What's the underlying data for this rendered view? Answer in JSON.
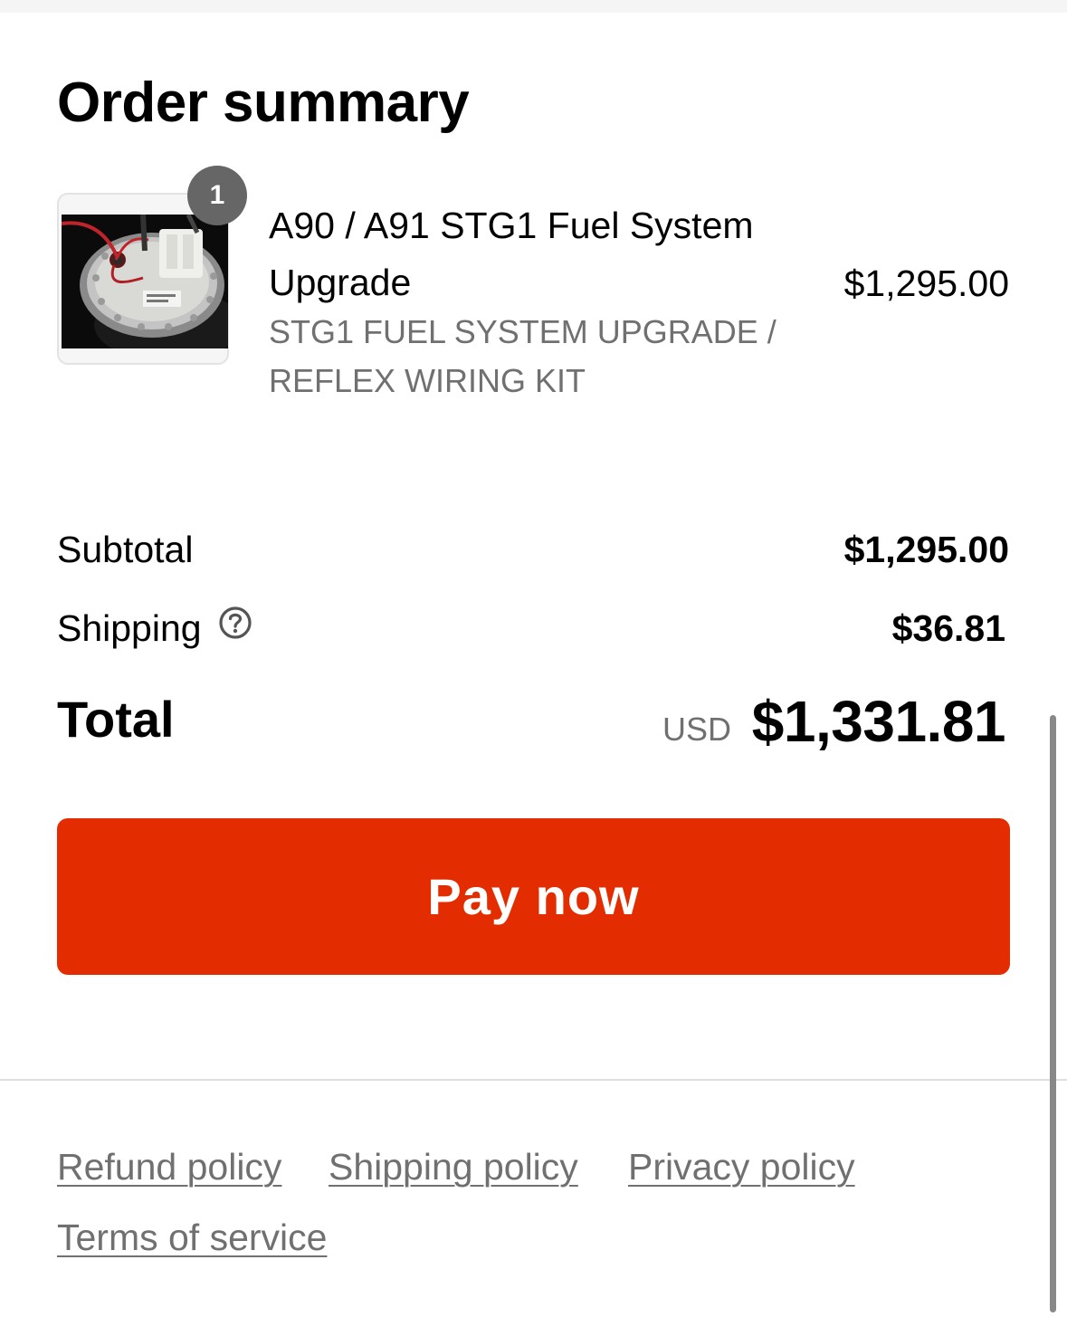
{
  "order_summary": {
    "title": "Order summary",
    "item": {
      "quantity": "1",
      "name": "A90 / A91 STG1 Fuel System Upgrade",
      "variant": "STG1 FUEL SYSTEM UPGRADE / REFLEX WIRING KIT",
      "price": "$1,295.00",
      "image_icon": "fuel-pump-image"
    },
    "subtotal": {
      "label": "Subtotal",
      "value": "$1,295.00"
    },
    "shipping": {
      "label": "Shipping",
      "value": "$36.81",
      "help_icon": "question-circle-icon"
    },
    "total": {
      "label": "Total",
      "currency": "USD",
      "value": "$1,331.81"
    }
  },
  "pay_button": {
    "label": "Pay now",
    "color": "#e32d00"
  },
  "footer": {
    "links": [
      "Refund policy",
      "Shipping policy",
      "Privacy policy",
      "Terms of service"
    ]
  }
}
